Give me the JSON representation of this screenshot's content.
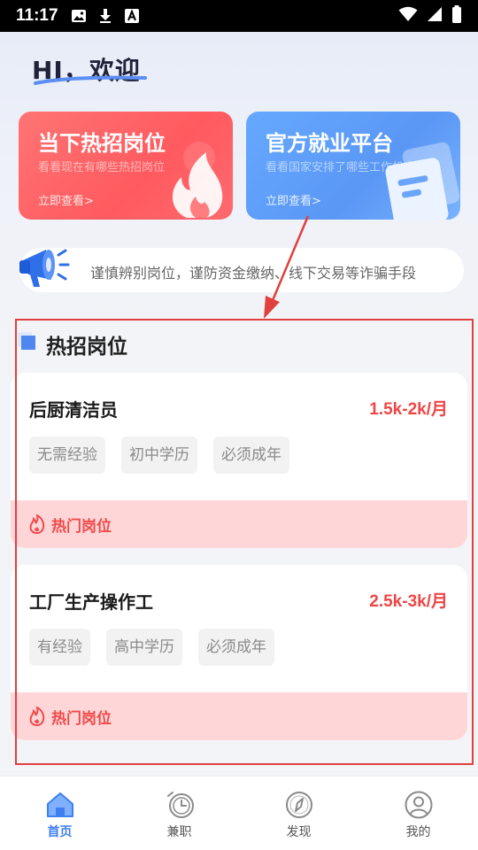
{
  "status_bar": {
    "time": "11:17",
    "left_icons": [
      "image-icon",
      "download-icon",
      "font-icon"
    ],
    "right_icons": [
      "wifi-icon",
      "signal-icon",
      "battery-icon"
    ]
  },
  "greeting": "HI，欢迎",
  "cards": [
    {
      "title": "当下热招岗位",
      "subtitle": "看看现在有哪些热招岗位",
      "link": "立即查看>",
      "icon": "flame-icon",
      "color": "#ff5f63"
    },
    {
      "title": "官方就业平台",
      "subtitle": "看看国家安排了哪些工作机会",
      "link": "立即查看>",
      "icon": "document-icon",
      "color": "#5c9af6"
    }
  ],
  "notice": {
    "icon": "megaphone-icon",
    "text": "谨慎辨别岗位，谨防资金缴纳、线下交易等诈骗手段"
  },
  "section": {
    "title": "热招岗位"
  },
  "jobs": [
    {
      "name": "后厨清洁员",
      "salary": "1.5k-2k/月",
      "tags": [
        "无需经验",
        "初中学历",
        "必须成年"
      ],
      "footer": "热门岗位"
    },
    {
      "name": "工厂生产操作工",
      "salary": "2.5k-3k/月",
      "tags": [
        "有经验",
        "高中学历",
        "必须成年"
      ],
      "footer": "热门岗位"
    }
  ],
  "nav": [
    {
      "label": "首页",
      "icon": "home-icon",
      "active": true
    },
    {
      "label": "兼职",
      "icon": "clock-icon",
      "active": false
    },
    {
      "label": "发现",
      "icon": "compass-icon",
      "active": false
    },
    {
      "label": "我的",
      "icon": "user-icon",
      "active": false
    }
  ],
  "colors": {
    "accent": "#3d7ff0",
    "danger": "#ef4545",
    "annotation": "#e0403e"
  }
}
